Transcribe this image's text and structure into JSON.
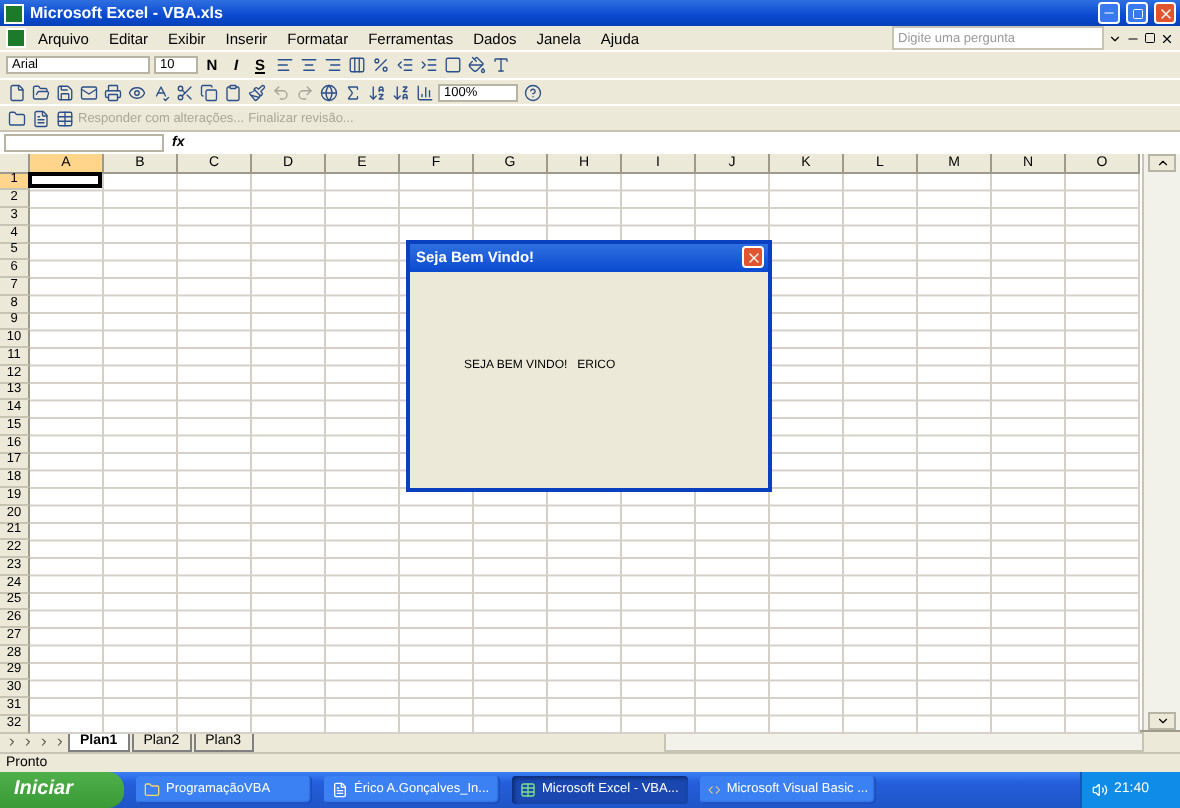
{
  "window": {
    "title": "Microsoft Excel - VBA.xls"
  },
  "menu": [
    {
      "label": "Arquivo"
    },
    {
      "label": "Editar"
    },
    {
      "label": "Exibir"
    },
    {
      "label": "Inserir"
    },
    {
      "label": "Formatar"
    },
    {
      "label": "Ferramentas"
    },
    {
      "label": "Dados"
    },
    {
      "label": "Janela"
    },
    {
      "label": "Ajuda"
    }
  ],
  "help_box": {
    "placeholder": "Digite uma pergunta"
  },
  "font": {
    "name": "Arial",
    "size": "10"
  },
  "style_buttons": [
    "N",
    "I",
    "S"
  ],
  "zoom": "100%",
  "review_toolbar": {
    "reply": "Responder com alterações...",
    "finish": "Finalizar revisão...",
    "disabled": true
  },
  "formula_bar": {
    "fx": "fx"
  },
  "columns": [
    {
      "label": "A",
      "selected": true
    },
    {
      "label": "B",
      "selected": false
    },
    {
      "label": "C",
      "selected": false
    },
    {
      "label": "D",
      "selected": false
    },
    {
      "label": "E",
      "selected": false
    },
    {
      "label": "F",
      "selected": false
    },
    {
      "label": "G",
      "selected": false
    },
    {
      "label": "H",
      "selected": false
    },
    {
      "label": "I",
      "selected": false
    },
    {
      "label": "J",
      "selected": false
    },
    {
      "label": "K",
      "selected": false
    },
    {
      "label": "L",
      "selected": false
    },
    {
      "label": "M",
      "selected": false
    },
    {
      "label": "N",
      "selected": false
    },
    {
      "label": "O",
      "selected": false
    }
  ],
  "rows": [
    {
      "label": "1",
      "selected": true
    },
    {
      "label": "2",
      "selected": false
    },
    {
      "label": "3",
      "selected": false
    },
    {
      "label": "4",
      "selected": false
    },
    {
      "label": "5",
      "selected": false
    },
    {
      "label": "6",
      "selected": false
    },
    {
      "label": "7",
      "selected": false
    },
    {
      "label": "8",
      "selected": false
    },
    {
      "label": "9",
      "selected": false
    },
    {
      "label": "10",
      "selected": false
    },
    {
      "label": "11",
      "selected": false
    },
    {
      "label": "12",
      "selected": false
    },
    {
      "label": "13",
      "selected": false
    },
    {
      "label": "14",
      "selected": false
    },
    {
      "label": "15",
      "selected": false
    },
    {
      "label": "16",
      "selected": false
    },
    {
      "label": "17",
      "selected": false
    },
    {
      "label": "18",
      "selected": false
    },
    {
      "label": "19",
      "selected": false
    },
    {
      "label": "20",
      "selected": false
    },
    {
      "label": "21",
      "selected": false
    },
    {
      "label": "22",
      "selected": false
    },
    {
      "label": "23",
      "selected": false
    },
    {
      "label": "24",
      "selected": false
    },
    {
      "label": "25",
      "selected": false
    },
    {
      "label": "26",
      "selected": false
    },
    {
      "label": "27",
      "selected": false
    },
    {
      "label": "28",
      "selected": false
    },
    {
      "label": "29",
      "selected": false
    },
    {
      "label": "30",
      "selected": false
    },
    {
      "label": "31",
      "selected": false
    },
    {
      "label": "32",
      "selected": false
    }
  ],
  "sheet_tabs": [
    {
      "label": "Plan1",
      "selected": true
    },
    {
      "label": "Plan2",
      "selected": false
    },
    {
      "label": "Plan3",
      "selected": false
    }
  ],
  "status_bar": {
    "text": "Pronto"
  },
  "dialog": {
    "title": "Seja Bem Vindo!",
    "message": "SEJA BEM VINDO!   ERICO"
  },
  "taskbar": {
    "start": "Iniciar",
    "tasks": [
      {
        "label": "ProgramaçãoVBA",
        "kind": "folder",
        "selected": false
      },
      {
        "label": "Érico A.Gonçalves_In...",
        "kind": "word",
        "selected": false
      },
      {
        "label": "Microsoft Excel - VBA...",
        "kind": "excel",
        "selected": true
      },
      {
        "label": "Microsoft Visual Basic ...",
        "kind": "vb",
        "selected": false
      }
    ],
    "clock": "21:40"
  }
}
